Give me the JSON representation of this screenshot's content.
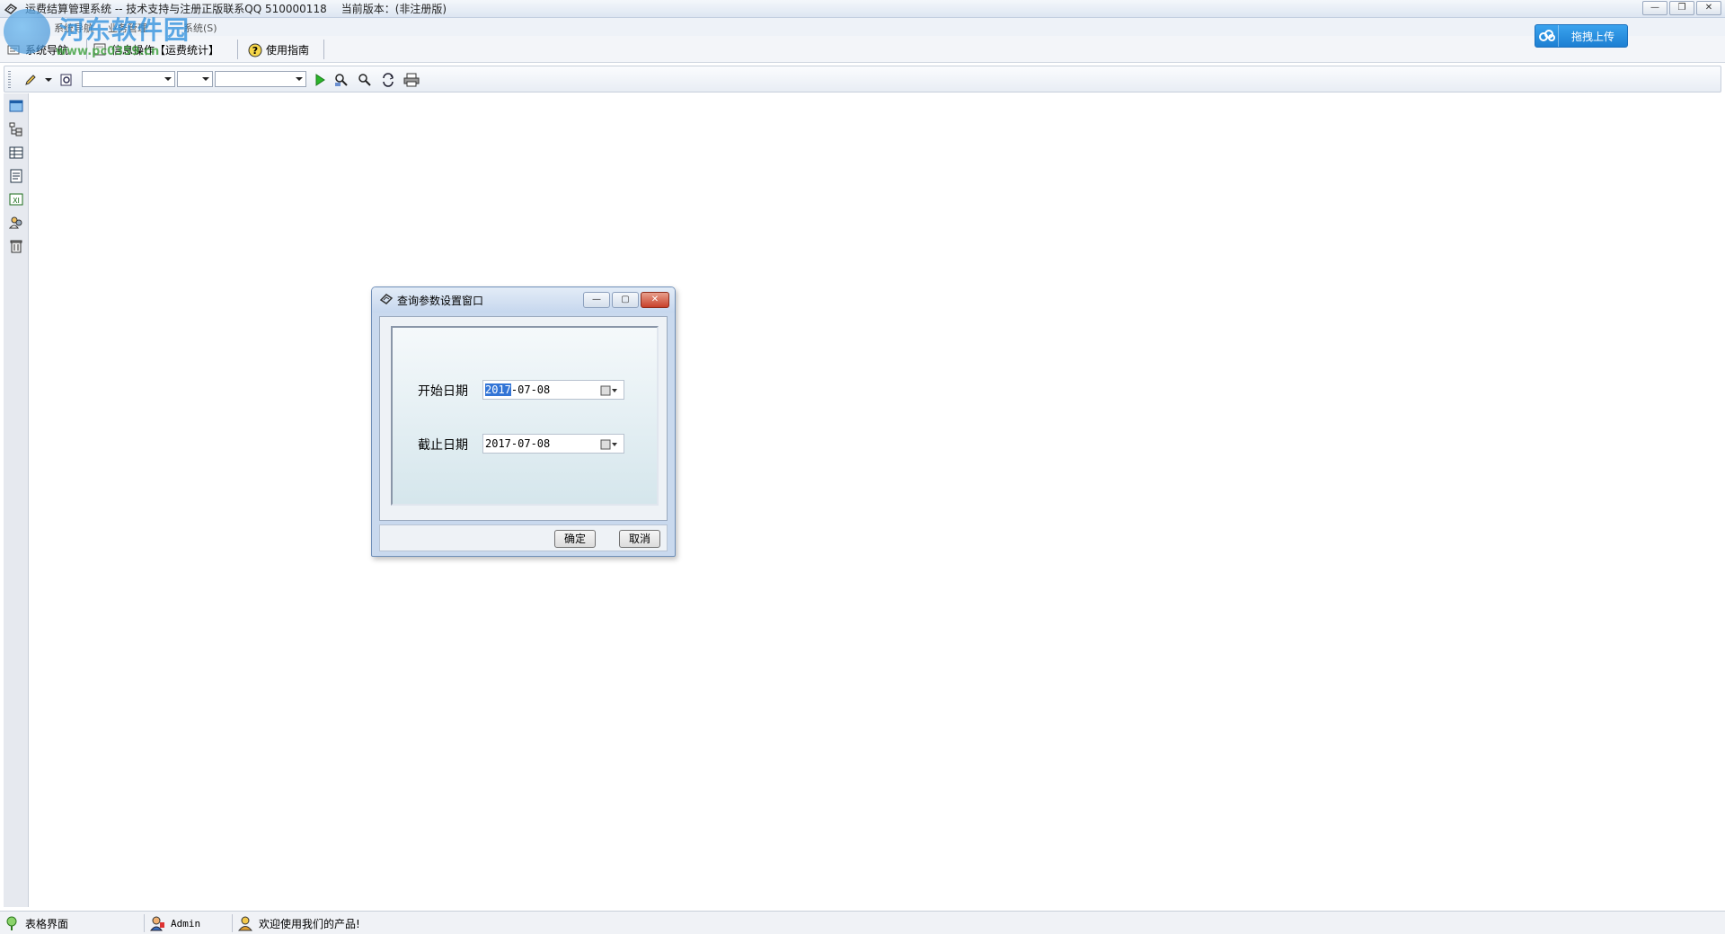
{
  "window": {
    "title": "运费结算管理系统 -- 技术支持与注册正版联系QQ 510000118",
    "version": "当前版本：(非注册版)",
    "controls": [
      "—",
      "❐",
      "✕"
    ]
  },
  "watermark": {
    "name": "河东软件园",
    "url": "www.pc0359.cn"
  },
  "menubar": {
    "items": [
      "系统导航",
      "业务管理",
      "系统(S)"
    ]
  },
  "navtabs": {
    "system_nav": "系统导航",
    "info_ops": "信息操作【运费统计】",
    "guide": "使用指南"
  },
  "upload": {
    "label": "拖拽上传"
  },
  "toolbar": {
    "combo1": "",
    "combo2": "",
    "combo3": ""
  },
  "dialog": {
    "title": "查询参数设置窗口",
    "start_label": "开始日期",
    "start_value_sel": "2017",
    "start_value_rest": "-07-08",
    "end_label": "截止日期",
    "end_value": "2017-07-08",
    "ok": "确定",
    "cancel": "取消"
  },
  "status": {
    "view": "表格界面",
    "user": "Admin",
    "welcome": "欢迎使用我们的产品!"
  }
}
